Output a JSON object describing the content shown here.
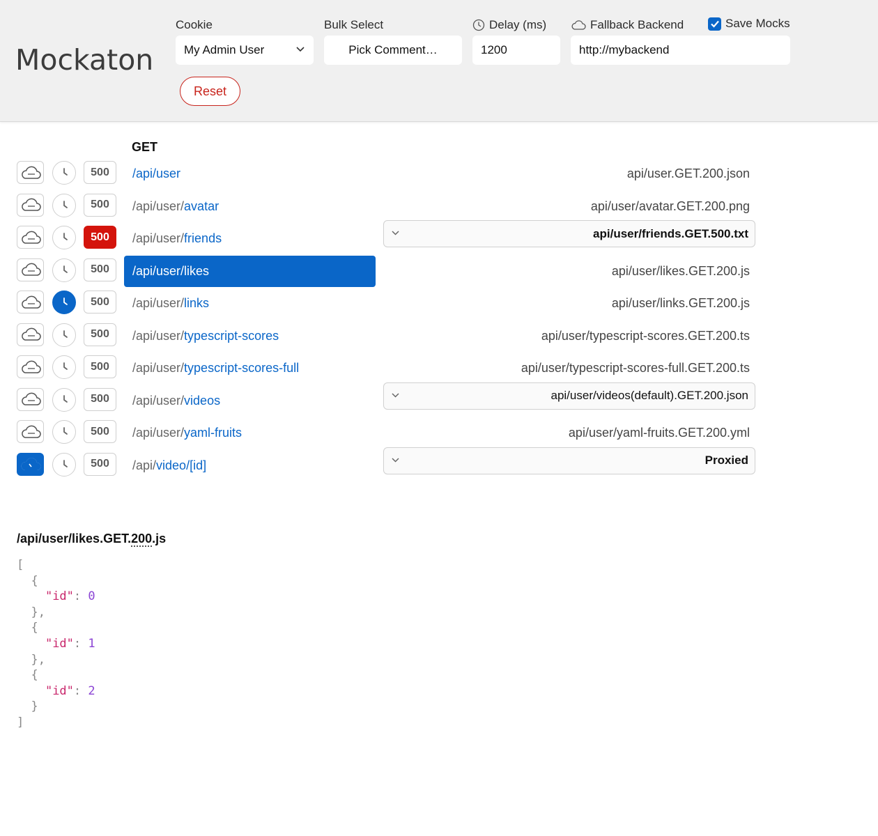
{
  "app": {
    "title": "Mockaton"
  },
  "header": {
    "cookie": {
      "label": "Cookie",
      "value": "My Admin User"
    },
    "bulk_select": {
      "label": "Bulk Select",
      "value": "Pick Comment…"
    },
    "delay": {
      "label": "Delay (ms)",
      "value": "1200"
    },
    "fallback": {
      "label": "Fallback Backend",
      "value": "http://mybackend"
    },
    "save_mocks": {
      "label": "Save Mocks",
      "checked": true
    },
    "reset_label": "Reset"
  },
  "method": "GET",
  "routes": [
    {
      "prefix": "",
      "main": "/api/user",
      "status_label": "500",
      "mock": "api/user.GET.200.json",
      "mock_type": "text",
      "cloud_on": false,
      "delay_on": false,
      "status_500_on": false,
      "selected": false
    },
    {
      "prefix": "/api/user/",
      "main": "avatar",
      "status_label": "500",
      "mock": "api/user/avatar.GET.200.png",
      "mock_type": "text",
      "cloud_on": false,
      "delay_on": false,
      "status_500_on": false,
      "selected": false
    },
    {
      "prefix": "/api/user/",
      "main": "friends",
      "status_label": "500",
      "mock": "api/user/friends.GET.500.txt",
      "mock_type": "select",
      "mock_bold": true,
      "cloud_on": false,
      "delay_on": false,
      "status_500_on": true,
      "selected": false
    },
    {
      "prefix": "/api/user/",
      "main": "likes",
      "status_label": "500",
      "mock": "api/user/likes.GET.200.js",
      "mock_type": "text",
      "cloud_on": false,
      "delay_on": false,
      "status_500_on": false,
      "selected": true
    },
    {
      "prefix": "/api/user/",
      "main": "links",
      "status_label": "500",
      "mock": "api/user/links.GET.200.js",
      "mock_type": "text",
      "cloud_on": false,
      "delay_on": true,
      "status_500_on": false,
      "selected": false
    },
    {
      "prefix": "/api/user/",
      "main": "typescript-scores",
      "status_label": "500",
      "mock": "api/user/typescript-scores.GET.200.ts",
      "mock_type": "text",
      "cloud_on": false,
      "delay_on": false,
      "status_500_on": false,
      "selected": false
    },
    {
      "prefix": "/api/user/",
      "main": "typescript-scores-full",
      "status_label": "500",
      "mock": "api/user/typescript-scores-full.GET.200.ts",
      "mock_type": "text",
      "cloud_on": false,
      "delay_on": false,
      "status_500_on": false,
      "selected": false
    },
    {
      "prefix": "/api/user/",
      "main": "videos",
      "status_label": "500",
      "mock": "api/user/videos(default).GET.200.json",
      "mock_type": "select",
      "mock_bold": false,
      "cloud_on": false,
      "delay_on": false,
      "status_500_on": false,
      "selected": false
    },
    {
      "prefix": "/api/user/",
      "main": "yaml-fruits",
      "status_label": "500",
      "mock": "api/user/yaml-fruits.GET.200.yml",
      "mock_type": "text",
      "cloud_on": false,
      "delay_on": false,
      "status_500_on": false,
      "selected": false
    },
    {
      "prefix": "/api/",
      "main": "video/[id]",
      "status_label": "500",
      "mock": "Proxied",
      "mock_type": "select",
      "mock_bold": true,
      "cloud_on": true,
      "delay_on": false,
      "status_500_on": false,
      "selected": false
    }
  ],
  "payload": {
    "title_prefix": "/api/user/likes.GET.",
    "title_status": "200",
    "title_suffix": ".js",
    "items": [
      {
        "key": "\"id\"",
        "value": "0"
      },
      {
        "key": "\"id\"",
        "value": "1"
      },
      {
        "key": "\"id\"",
        "value": "2"
      }
    ]
  },
  "colors": {
    "accent": "#0a66c8",
    "danger": "#d4140c",
    "header_bg": "#f0f0f0"
  }
}
